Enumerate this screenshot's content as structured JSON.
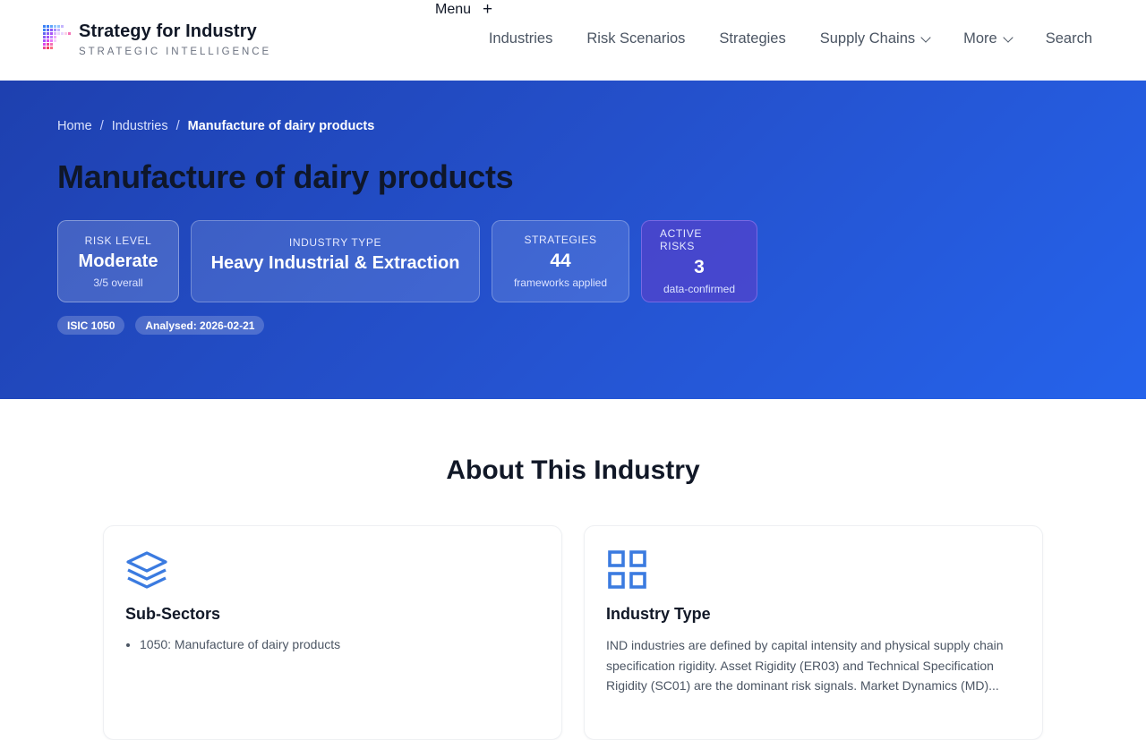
{
  "brand": {
    "title": "Strategy for Industry",
    "subtitle": "STRATEGIC INTELLIGENCE"
  },
  "header": {
    "menu_label": "Menu",
    "menu_icon": "plus-icon",
    "nav": [
      {
        "label": "Industries"
      },
      {
        "label": "Risk Scenarios"
      },
      {
        "label": "Strategies"
      },
      {
        "label": "Supply Chains",
        "has_dropdown": true
      },
      {
        "label": "More",
        "has_dropdown": true
      },
      {
        "label": "Search"
      }
    ]
  },
  "hero": {
    "breadcrumb": [
      "Home",
      "Industries",
      "Manufacture of dairy products"
    ],
    "breadcrumb_separator": "/",
    "title": "Manufacture of dairy products",
    "stats": {
      "risk": {
        "label": "RISK LEVEL",
        "value": "Moderate",
        "sub": "3/5 overall"
      },
      "type": {
        "label": "INDUSTRY TYPE",
        "value": "Heavy Industrial & Extraction"
      },
      "strategies": {
        "label": "STRATEGIES",
        "value": "44",
        "sub": "frameworks applied"
      },
      "active": {
        "label": "ACTIVE RISKS",
        "value": "3",
        "sub": "data-confirmed"
      }
    },
    "tags": [
      "ISIC 1050",
      "Analysed: 2026-02-21"
    ]
  },
  "about": {
    "title": "About This Industry",
    "subsectors": {
      "icon": "layers-icon",
      "title": "Sub-Sectors",
      "items": [
        "1050: Manufacture of dairy products"
      ]
    },
    "industry_type": {
      "icon": "grid-icon",
      "title": "Industry Type",
      "text": "IND industries are defined by capital intensity and physical supply chain specification rigidity. Asset Rigidity (ER03) and Technical Specification Rigidity (SC01) are the dominant risk signals. Market Dynamics (MD)..."
    }
  },
  "colors": {
    "hero_start": "#1e40af",
    "hero_end": "#2563eb",
    "icon_accent": "#3b7be0",
    "active_risk_bg": "#5b3cc4"
  }
}
